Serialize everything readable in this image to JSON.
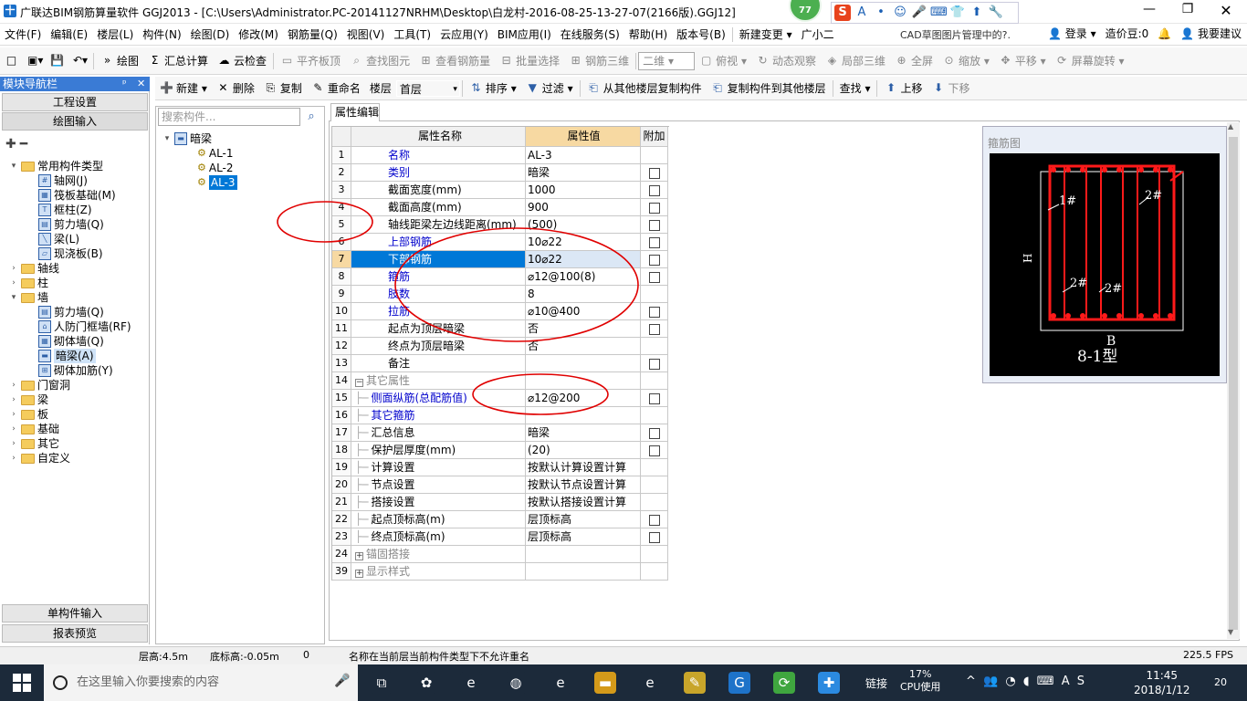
{
  "window": {
    "title": "广联达BIM钢筋算量软件 GGJ2013 - [C:\\Users\\Administrator.PC-20141127NRHM\\Desktop\\白龙村-2016-08-25-13-27-07(2166版).GGJ12]",
    "app_icon_glyph": "十",
    "min": "—",
    "max": "❐",
    "close": "✕",
    "badge": "77"
  },
  "ime_bar": [
    "S",
    "A",
    "•",
    "☺",
    "🎤",
    "⌨",
    "👕",
    "⬆",
    "🔧"
  ],
  "menu": [
    "文件(F)",
    "编辑(E)",
    "楼层(L)",
    "构件(N)",
    "绘图(D)",
    "修改(M)",
    "钢筋量(Q)",
    "视图(V)",
    "工具(T)",
    "云应用(Y)",
    "BIM应用(I)",
    "在线服务(S)",
    "帮助(H)",
    "版本号(B)",
    "新建变更 ▾",
    "广小二"
  ],
  "cad_link": "CAD草图图片管理中的?.",
  "menu_right": {
    "login": "登录 ▾",
    "cost_beans": "造价豆:0",
    "suggest": "我要建议"
  },
  "toolbar1": [
    {
      "label": "",
      "icon": "□",
      "dis": false
    },
    {
      "label": "",
      "icon": "▣▾",
      "dis": false
    },
    {
      "label": "",
      "icon": "💾",
      "dis": false
    },
    {
      "label": "",
      "icon": "↶▾",
      "dis": false
    },
    {
      "label": "绘图",
      "icon": "»",
      "dis": false
    },
    {
      "label": "汇总计算",
      "icon": "Σ",
      "dis": false
    },
    {
      "label": "云检查",
      "icon": "☁",
      "dis": false
    },
    {
      "label": "平齐板顶",
      "icon": "▭",
      "dis": true
    },
    {
      "label": "查找图元",
      "icon": "⌕",
      "dis": true
    },
    {
      "label": "查看钢筋量",
      "icon": "⊞",
      "dis": true
    },
    {
      "label": "批量选择",
      "icon": "⊟",
      "dis": true
    },
    {
      "label": "钢筋三维",
      "icon": "⊞",
      "dis": true
    }
  ],
  "toolbar1_view_select": "二维 ▾",
  "toolbar1_right": [
    {
      "label": "俯视 ▾",
      "icon": "▢"
    },
    {
      "label": "动态观察",
      "icon": "↻"
    },
    {
      "label": "局部三维",
      "icon": "◈"
    },
    {
      "label": "全屏",
      "icon": "⊕"
    },
    {
      "label": "缩放 ▾",
      "icon": "⊙"
    },
    {
      "label": "平移 ▾",
      "icon": "✥"
    },
    {
      "label": "屏幕旋转 ▾",
      "icon": "⟳"
    }
  ],
  "toolbar2": [
    {
      "label": "新建 ▾",
      "icon": "➕"
    },
    {
      "label": "删除",
      "icon": "✕"
    },
    {
      "label": "复制",
      "icon": "⎘"
    },
    {
      "label": "重命名",
      "icon": "✎"
    },
    {
      "label": "楼层",
      "icon": ""
    }
  ],
  "floor_value": "首层",
  "toolbar2_right": [
    {
      "label": "排序 ▾",
      "icon": "⇅"
    },
    {
      "label": "过滤 ▾",
      "icon": "▼"
    },
    {
      "label": "从其他楼层复制构件",
      "icon": "⎗"
    },
    {
      "label": "复制构件到其他楼层",
      "icon": "⎗"
    },
    {
      "label": "查找 ▾",
      "icon": ""
    },
    {
      "label": "上移",
      "icon": "⬆"
    },
    {
      "label": "下移",
      "icon": "⬇"
    }
  ],
  "nav": {
    "title": "模块导航栏",
    "pin": "ᵖ",
    "close": "✕",
    "sections": [
      "工程设置",
      "绘图输入"
    ],
    "tools": "⁺₊ ⁼",
    "tree": [
      {
        "label": "常用构件类型",
        "level": 0,
        "exp": "▾",
        "type": "folder"
      },
      {
        "label": "轴网(J)",
        "level": 1,
        "exp": "",
        "type": "comp",
        "ico": "#"
      },
      {
        "label": "筏板基础(M)",
        "level": 1,
        "exp": "",
        "type": "comp",
        "ico": "▦"
      },
      {
        "label": "框柱(Z)",
        "level": 1,
        "exp": "",
        "type": "comp",
        "ico": "T"
      },
      {
        "label": "剪力墙(Q)",
        "level": 1,
        "exp": "",
        "type": "comp",
        "ico": "▤"
      },
      {
        "label": "梁(L)",
        "level": 1,
        "exp": "",
        "type": "comp",
        "ico": "╲"
      },
      {
        "label": "现浇板(B)",
        "level": 1,
        "exp": "",
        "type": "comp",
        "ico": "▱"
      },
      {
        "label": "轴线",
        "level": 0,
        "exp": "›",
        "type": "folder"
      },
      {
        "label": "柱",
        "level": 0,
        "exp": "›",
        "type": "folder"
      },
      {
        "label": "墙",
        "level": 0,
        "exp": "▾",
        "type": "folder"
      },
      {
        "label": "剪力墙(Q)",
        "level": 1,
        "exp": "",
        "type": "comp",
        "ico": "▤"
      },
      {
        "label": "人防门框墙(RF)",
        "level": 1,
        "exp": "",
        "type": "comp",
        "ico": "⌂"
      },
      {
        "label": "砌体墙(Q)",
        "level": 1,
        "exp": "",
        "type": "comp",
        "ico": "▦"
      },
      {
        "label": "暗梁(A)",
        "level": 1,
        "exp": "",
        "type": "comp",
        "ico": "▬",
        "selected": true
      },
      {
        "label": "砌体加筋(Y)",
        "level": 1,
        "exp": "",
        "type": "comp",
        "ico": "⊞"
      },
      {
        "label": "门窗洞",
        "level": 0,
        "exp": "›",
        "type": "folder"
      },
      {
        "label": "梁",
        "level": 0,
        "exp": "›",
        "type": "folder"
      },
      {
        "label": "板",
        "level": 0,
        "exp": "›",
        "type": "folder"
      },
      {
        "label": "基础",
        "level": 0,
        "exp": "›",
        "type": "folder"
      },
      {
        "label": "其它",
        "level": 0,
        "exp": "›",
        "type": "folder"
      },
      {
        "label": "自定义",
        "level": 0,
        "exp": "›",
        "type": "folder"
      }
    ],
    "bottom": [
      "单构件输入",
      "报表预览"
    ]
  },
  "list": {
    "search_placeholder": "搜索构件...",
    "search_icon": "⌕",
    "root": "暗梁",
    "items": [
      "AL-1",
      "AL-2",
      "AL-3"
    ],
    "selected": "AL-3"
  },
  "props": {
    "tab": "属性编辑",
    "headers": {
      "name": "属性名称",
      "value": "属性值",
      "add": "附加"
    },
    "rows": [
      {
        "no": "1",
        "name": "名称",
        "value": "AL-3",
        "blue": true,
        "chk": false
      },
      {
        "no": "2",
        "name": "类别",
        "value": "暗梁",
        "blue": true,
        "chk": true
      },
      {
        "no": "3",
        "name": "截面宽度(mm)",
        "value": "1000",
        "blue": false,
        "chk": true
      },
      {
        "no": "4",
        "name": "截面高度(mm)",
        "value": "900",
        "blue": false,
        "chk": true
      },
      {
        "no": "5",
        "name": "轴线距梁左边线距离(mm)",
        "value": "(500)",
        "blue": false,
        "chk": true
      },
      {
        "no": "6",
        "name": "上部钢筋",
        "value": "10⌀22",
        "blue": true,
        "chk": true
      },
      {
        "no": "7",
        "name": "下部钢筋",
        "value": "10⌀22",
        "blue": true,
        "chk": true,
        "sel": true
      },
      {
        "no": "8",
        "name": "箍筋",
        "value": "⌀12@100(8)",
        "blue": true,
        "chk": true
      },
      {
        "no": "9",
        "name": "肢数",
        "value": "8",
        "blue": true,
        "chk": false
      },
      {
        "no": "10",
        "name": "拉筋",
        "value": "⌀10@400",
        "blue": true,
        "chk": true
      },
      {
        "no": "11",
        "name": "起点为顶层暗梁",
        "value": "否",
        "blue": false,
        "chk": true
      },
      {
        "no": "12",
        "name": "终点为顶层暗梁",
        "value": "否",
        "blue": false,
        "chk": false
      },
      {
        "no": "13",
        "name": "备注",
        "value": "",
        "blue": false,
        "chk": true
      },
      {
        "no": "14",
        "name": "其它属性",
        "value": "",
        "blue": false,
        "chk": false,
        "group": true,
        "box": "−"
      },
      {
        "no": "15",
        "name": "侧面纵筋(总配筋值)",
        "value": "⌀12@200",
        "blue": true,
        "chk": true,
        "indent": true
      },
      {
        "no": "16",
        "name": "其它箍筋",
        "value": "",
        "blue": true,
        "chk": false,
        "indent": true
      },
      {
        "no": "17",
        "name": "汇总信息",
        "value": "暗梁",
        "blue": false,
        "chk": true,
        "indent": true
      },
      {
        "no": "18",
        "name": "保护层厚度(mm)",
        "value": "(20)",
        "blue": false,
        "chk": true,
        "indent": true
      },
      {
        "no": "19",
        "name": "计算设置",
        "value": "按默认计算设置计算",
        "blue": false,
        "chk": false,
        "indent": true
      },
      {
        "no": "20",
        "name": "节点设置",
        "value": "按默认节点设置计算",
        "blue": false,
        "chk": false,
        "indent": true
      },
      {
        "no": "21",
        "name": "搭接设置",
        "value": "按默认搭接设置计算",
        "blue": false,
        "chk": false,
        "indent": true
      },
      {
        "no": "22",
        "name": "起点顶标高(m)",
        "value": "层顶标高",
        "blue": false,
        "chk": true,
        "indent": true
      },
      {
        "no": "23",
        "name": "终点顶标高(m)",
        "value": "层顶标高",
        "blue": false,
        "chk": true,
        "indent": true
      },
      {
        "no": "24",
        "name": "锚固搭接",
        "value": "",
        "blue": false,
        "chk": false,
        "group": true,
        "box": "+"
      },
      {
        "no": "39",
        "name": "显示样式",
        "value": "",
        "blue": false,
        "chk": false,
        "group": true,
        "box": "+"
      }
    ]
  },
  "stirrup": {
    "title": "箍筋图",
    "label_h": "H",
    "label_b": "B",
    "type": "8-1型",
    "tags": [
      "1#",
      "2#",
      "2#",
      "2#"
    ]
  },
  "status": {
    "floor_height": "层高:4.5m",
    "base_elev": "底标高:-0.05m",
    "zero": "0",
    "message": "名称在当前层当前构件类型下不允许重名",
    "fps": "225.5 FPS"
  },
  "taskbar": {
    "search_placeholder": "在这里输入你要搜索的内容",
    "mic": "🎤",
    "apps": [
      "⧉",
      "✿",
      "e",
      "◍",
      "e",
      "▬",
      "e",
      "✎",
      "G",
      "⟳",
      "✚"
    ],
    "link": "链接",
    "cpu_pct": "17%",
    "cpu_label": "CPU使用",
    "tray": "^ 👥 ◔ ◖ ⌨ A S",
    "time": "11:45",
    "date": "2018/1/12",
    "notif": "20"
  },
  "colors": {
    "accent": "#0078d7",
    "value_header": "#f7d9a2",
    "rebar": "#ff0000",
    "annotation": "#e00000"
  }
}
